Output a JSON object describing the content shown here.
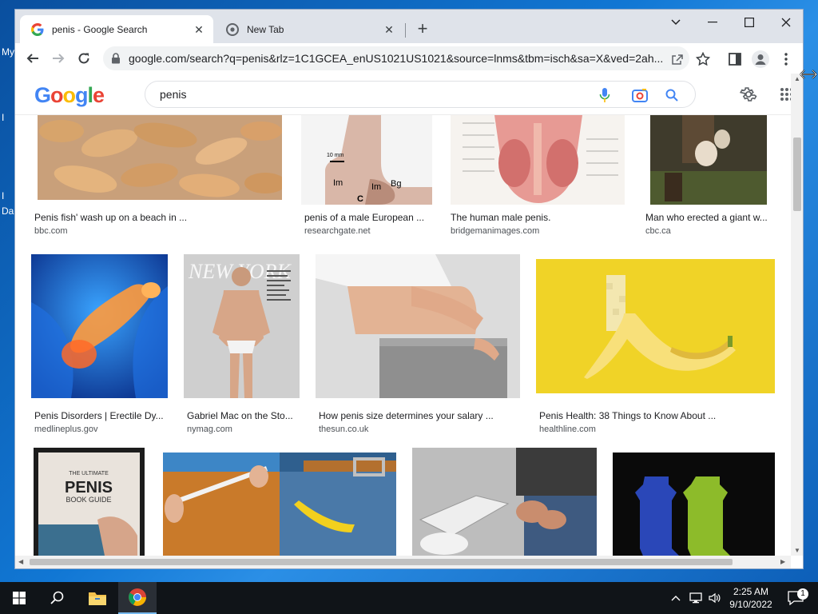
{
  "desktop": {
    "labels": [
      "My",
      "I",
      "I",
      "Da"
    ]
  },
  "browser": {
    "tabs": [
      {
        "title": "penis - Google Search",
        "active": true
      },
      {
        "title": "New Tab",
        "active": false
      }
    ],
    "url": "google.com/search?q=penis&rlz=1C1GCEA_enUS1021US1021&source=lnms&tbm=isch&sa=X&ved=2ah..."
  },
  "google": {
    "logo_letters": [
      {
        "ch": "G",
        "color": "#4285F4"
      },
      {
        "ch": "o",
        "color": "#EA4335"
      },
      {
        "ch": "o",
        "color": "#FBBC05"
      },
      {
        "ch": "g",
        "color": "#4285F4"
      },
      {
        "ch": "l",
        "color": "#34A853"
      },
      {
        "ch": "e",
        "color": "#EA4335"
      }
    ],
    "query": "penis"
  },
  "results": [
    {
      "title": "Penis fish' wash up on a beach in ...",
      "source": "bbc.com"
    },
    {
      "title": "penis of a male European ...",
      "source": "researchgate.net"
    },
    {
      "title": "The human male penis.",
      "source": "bridgemanimages.com"
    },
    {
      "title": "Man who erected a giant w...",
      "source": "cbc.ca"
    },
    {
      "title": "Penis Disorders | Erectile Dy...",
      "source": "medlineplus.gov"
    },
    {
      "title": "Gabriel Mac on the Sto...",
      "source": "nymag.com"
    },
    {
      "title": "How penis size determines your salary ...",
      "source": "thesun.co.uk"
    },
    {
      "title": "Penis Health: 38 Things to Know About ...",
      "source": "healthline.com"
    },
    {
      "title": "",
      "source": ""
    },
    {
      "title": "",
      "source": ""
    },
    {
      "title": "",
      "source": ""
    },
    {
      "title": "",
      "source": ""
    }
  ],
  "thumb_text": {
    "magazine": "NEW YORK",
    "book_small": "THE ULTIMATE",
    "book_big": "PENIS",
    "book_sub": "BOOK GUIDE",
    "diagram_labels": [
      "10 mm",
      "Im",
      "Im",
      "Bg",
      "C"
    ]
  },
  "taskbar": {
    "time": "2:25 AM",
    "date": "9/10/2022",
    "notification_count": "1"
  },
  "colors": {
    "accent": "#1a73e8",
    "taskbar": "#101418",
    "tab_strip": "#dfe3ea"
  }
}
